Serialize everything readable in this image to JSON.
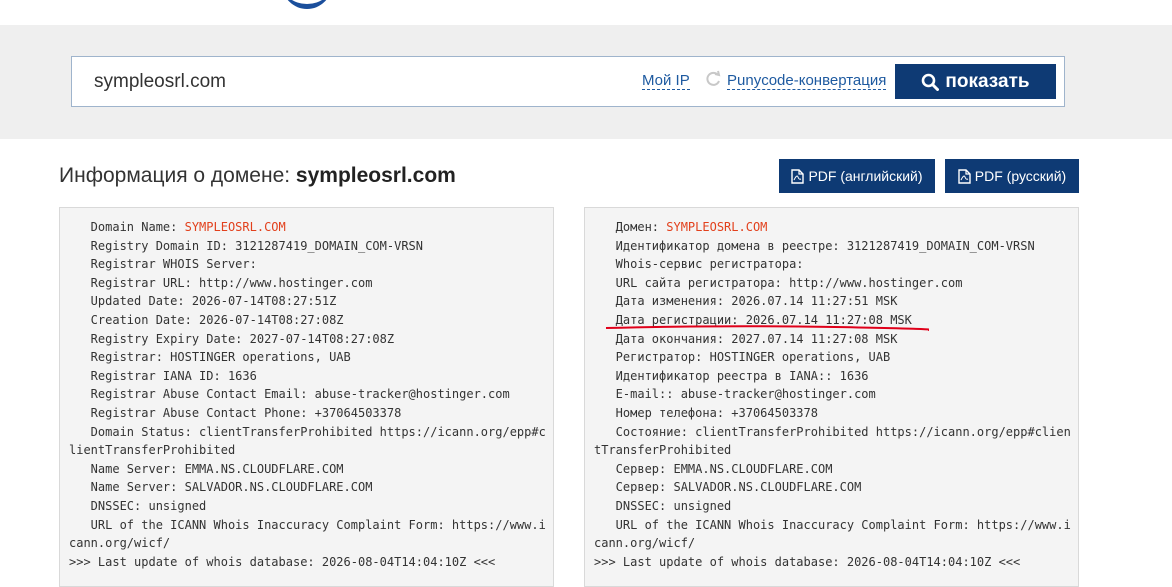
{
  "search": {
    "value": "sympleosrl.com",
    "my_ip_label": "Мой IP",
    "punycode_label": "Punycode-конвертация",
    "show_button_label": "показать"
  },
  "title": {
    "prefix": "Информация о домене: ",
    "domain": "sympleosrl.com"
  },
  "pdf": {
    "english_label": "PDF (английский)",
    "russian_label": "PDF (русский)"
  },
  "whois_en": {
    "l1_key": "   Domain Name: ",
    "l1_val": "SYMPLEOSRL.COM",
    "lines": [
      "   Registry Domain ID: 3121287419_DOMAIN_COM-VRSN",
      "   Registrar WHOIS Server:",
      "   Registrar URL: http://www.hostinger.com",
      "   Updated Date: 2026-07-14T08:27:51Z",
      "   Creation Date: 2026-07-14T08:27:08Z",
      "   Registry Expiry Date: 2027-07-14T08:27:08Z",
      "   Registrar: HOSTINGER operations, UAB",
      "   Registrar IANA ID: 1636",
      "   Registrar Abuse Contact Email: abuse-tracker@hostinger.com",
      "   Registrar Abuse Contact Phone: +37064503378",
      "   Domain Status: clientTransferProhibited https://icann.org/epp#c",
      "lientTransferProhibited",
      "   Name Server: EMMA.NS.CLOUDFLARE.COM",
      "   Name Server: SALVADOR.NS.CLOUDFLARE.COM",
      "   DNSSEC: unsigned",
      "   URL of the ICANN Whois Inaccuracy Complaint Form: https://www.i",
      "cann.org/wicf/",
      ">>> Last update of whois database: 2026-08-04T14:04:10Z <<<"
    ]
  },
  "whois_ru": {
    "l1_key": "   Домен: ",
    "l1_val": "SYMPLEOSRL.COM",
    "lines": [
      "   Идентификатор домена в реестре: 3121287419_DOMAIN_COM-VRSN",
      "   Whois-сервис регистратора:",
      "   URL сайта регистратора: http://www.hostinger.com",
      "   Дата изменения: 2026.07.14 11:27:51 MSK",
      "   Дата регистрации: 2026.07.14 11:27:08 MSK",
      "   Дата окончания: 2027.07.14 11:27:08 MSK",
      "   Регистратор: HOSTINGER operations, UAB",
      "   Идентификатор реестра в IANA:: 1636",
      "   E-mail:: abuse-tracker@hostinger.com",
      "   Номер телефона: +37064503378",
      "   Состояние: clientTransferProhibited https://icann.org/epp#clien",
      "tTransferProhibited",
      "   Сервер: EMMA.NS.CLOUDFLARE.COM",
      "   Сервер: SALVADOR.NS.CLOUDFLARE.COM",
      "   DNSSEC: unsigned",
      "   URL of the ICANN Whois Inaccuracy Complaint Form: https://www.i",
      "cann.org/wicf/",
      ">>> Last update of whois database: 2026-08-04T14:04:10Z <<<"
    ]
  },
  "colors": {
    "brand_dark": "#0e3a74",
    "link": "#1e5aa0",
    "highlight_value": "#e2401c",
    "annotation": "#e0001a"
  }
}
